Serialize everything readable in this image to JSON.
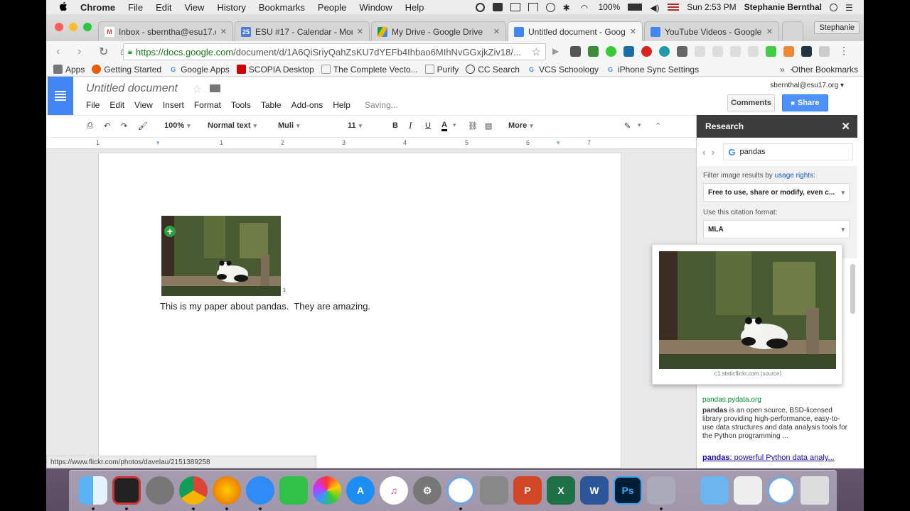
{
  "menubar": {
    "app": "Chrome",
    "items": [
      "File",
      "Edit",
      "View",
      "History",
      "Bookmarks",
      "People",
      "Window",
      "Help"
    ],
    "battery": "100%",
    "clock": "Sun 2:53 PM",
    "user": "Stephanie Bernthal"
  },
  "tabs": [
    {
      "title": "Inbox - sberntha@esu17.o",
      "fav": "M",
      "color": "#d44638"
    },
    {
      "title": "ESU #17 - Calendar - Mont",
      "fav": "25",
      "color": "#4a7ad8"
    },
    {
      "title": "My Drive - Google Drive",
      "fav": "",
      "color": "#f4b400"
    },
    {
      "title": "Untitled document - Googl",
      "fav": "",
      "color": "#4285f4"
    },
    {
      "title": "YouTube Videos - Google D",
      "fav": "",
      "color": "#4285f4"
    }
  ],
  "profile": "Stephanie",
  "omnibox": {
    "host": "https://docs.google.com",
    "rest": "/document/d/1A6QiSriyQahZsKU7dYEFb4Ihbao6MIhNvGGxjkZiv18/..."
  },
  "bookmarks": [
    {
      "label": "Apps",
      "color": "#777"
    },
    {
      "label": "Getting Started",
      "color": "#e66000"
    },
    {
      "label": "Google Apps",
      "color": "#4285f4"
    },
    {
      "label": "SCOPIA Desktop",
      "color": "#c00"
    },
    {
      "label": "The Complete Vecto...",
      "color": "#999"
    },
    {
      "label": "Purify",
      "color": "#999"
    },
    {
      "label": "CC Search",
      "color": "#333"
    },
    {
      "label": "VCS Schoology",
      "color": "#4285f4"
    },
    {
      "label": "iPhone Sync Settings",
      "color": "#4285f4"
    }
  ],
  "other_bookmarks": "Other Bookmarks",
  "docs": {
    "title": "Untitled document",
    "menu": [
      "File",
      "Edit",
      "View",
      "Insert",
      "Format",
      "Tools",
      "Table",
      "Add-ons",
      "Help"
    ],
    "saving": "Saving...",
    "account": "sbernthal@esu17.org",
    "comments": "Comments",
    "share": "Share"
  },
  "format_bar": {
    "zoom": "100%",
    "style": "Normal text",
    "font": "Muli",
    "size": "11",
    "more": "More"
  },
  "ruler": [
    "1",
    "1",
    "2",
    "3",
    "4",
    "5",
    "6",
    "7"
  ],
  "document": {
    "body": "This is my paper about pandas.  They are amazing.",
    "footnote": "1"
  },
  "research": {
    "title": "Research",
    "query": "pandas",
    "filter_label": "Filter image results by",
    "filter_link": "usage rights",
    "filter_value": "Free to use, share or modify, even c...",
    "citation_label": "Use this citation format:",
    "citation_value": "MLA",
    "preview_caption": "c1.staticflickr.com (source)",
    "result_url": "pandas.pydata.org",
    "result_term": "pandas",
    "result_snippet": " is an open source, BSD-licensed library providing high-performance, easy-to-use data structures and data analysis tools for the Python programming ...",
    "result_link_term": "pandas",
    "result_link_rest": ": powerful Python data analy..."
  },
  "status_url": "https://www.flickr.com/photos/davelau/2151389258",
  "dock": [
    "Finder",
    "Photo Booth",
    "Launchpad",
    "Chrome",
    "Firefox",
    "Messages",
    "FaceTime",
    "Photos",
    "App Store",
    "iTunes",
    "System Preferences",
    "Screenshot",
    "Calculator",
    "PowerPoint",
    "Excel",
    "Word",
    "Photoshop",
    "Preview",
    "Downloads",
    "Documents",
    "Screenshot 2",
    "Trash"
  ]
}
